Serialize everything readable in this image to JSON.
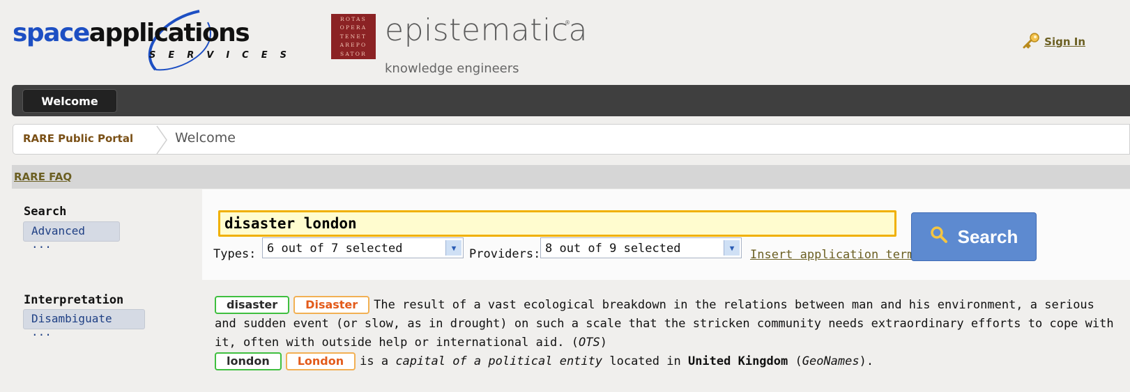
{
  "header": {
    "logo_left": {
      "part1": "space",
      "part2": "applications",
      "sub": "SERVICES"
    },
    "logo_right": {
      "square_lines": [
        "ROTAS",
        "OPERA",
        "TENET",
        "AREPO",
        "SATOR"
      ],
      "title": "epistematica",
      "tagline": "knowledge engineers"
    },
    "sign_in": "Sign In"
  },
  "nav": {
    "tabs": [
      {
        "label": "Welcome",
        "active": true
      }
    ]
  },
  "breadcrumb": {
    "root": "RARE Public Portal",
    "current": "Welcome"
  },
  "faq": {
    "label": "RARE FAQ"
  },
  "search": {
    "section_label": "Search",
    "advanced_button": "Advanced ...",
    "query": "disaster london",
    "types_label": "Types:",
    "types_value": "6 out of 7 selected",
    "providers_label": "Providers:",
    "providers_value": "8 out of 9 selected",
    "insert_term": "Insert application term",
    "button_label": "Search"
  },
  "interpretation": {
    "section_label": "Interpretation",
    "disambiguate_button": "Disambiguate ...",
    "entries": [
      {
        "term": "disaster",
        "concept": "Disaster",
        "text": "The result of a vast ecological breakdown in the relations between man and his environment, a serious and sudden event (or slow, as in drought) on such a scale that the stricken community needs extraordinary efforts to cope with it, often with outside help or international aid. (",
        "source": "OTS",
        "text_end": ")"
      },
      {
        "term": "london",
        "concept": "London",
        "pre": "is a ",
        "type": "capital of a political entity",
        "mid": " located in ",
        "place": "United Kingdom",
        "post_open": " (",
        "source": "GeoNames",
        "post_close": ")."
      }
    ]
  },
  "colors": {
    "nav_bg": "#3f3f3f",
    "search_button": "#5d8ad0",
    "input_border": "#f0b000",
    "tag_green": "#3fbf3f",
    "tag_orange": "#f2b053",
    "link": "#6b5f22"
  },
  "icons": {
    "sign_in": "key-icon",
    "search": "magnifier-icon",
    "dropdown": "chevron-down-icon"
  }
}
